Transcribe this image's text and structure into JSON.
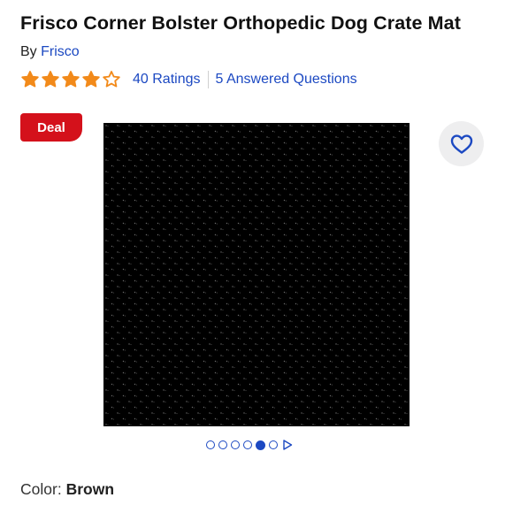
{
  "product": {
    "title": "Frisco Corner Bolster Orthopedic Dog Crate Mat",
    "by_prefix": "By",
    "brand": "Frisco"
  },
  "rating": {
    "value": 4.0,
    "max": 5,
    "ratings_text": "40 Ratings",
    "questions_text": "5 Answered Questions",
    "star_color": "#f28a1a"
  },
  "badge": {
    "label": "Deal",
    "color": "#d4111b"
  },
  "gallery": {
    "image_name": "product-photo-mesh-fabric",
    "total_images": 6,
    "active_index": 4,
    "next_icon": "play-triangle-icon"
  },
  "favorite": {
    "icon": "heart-outline-icon"
  },
  "options": {
    "color_label": "Color:",
    "color_value": "Brown"
  },
  "colors": {
    "link": "#1c49c2",
    "heart_bg": "#eeeeef"
  }
}
